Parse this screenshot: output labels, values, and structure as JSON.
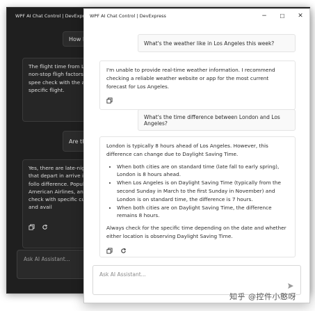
{
  "dark_window": {
    "title": "WPF AI Chat Control | DevExpress",
    "messages": [
      {
        "role": "user",
        "text": "How long"
      },
      {
        "role": "assistant",
        "text": "The flight time from Londo hours for a non-stop fligh factors such as wind spee check with the airline for t specific flight."
      },
      {
        "role": "user",
        "text": "Are there"
      },
      {
        "role": "assistant",
        "text": "Yes, there are late-night fl offer flights that depart in arrive in New York the follo difference. Popular airline American Airlines, and Vir best to check with specific current schedule and avail"
      }
    ],
    "input_placeholder": "Ask AI Assistant..."
  },
  "light_window": {
    "title": "WPF AI Chat Control | DevExpress",
    "controls": {
      "minimize": "−",
      "maximize": "☐",
      "close": "✕"
    },
    "messages": {
      "user1": "What's the weather like in Los Angeles this week?",
      "bot1": "I'm unable to provide real-time weather information. I recommend checking a reliable weather website or app for the most current forecast for Los Angeles.",
      "user2": "What's the time difference between London and Los Angeles?",
      "bot2_intro": "London is typically 8 hours ahead of Los Angeles. However, this difference can change due to Daylight Saving Time.",
      "bot2_bullets": [
        "When both cities are on standard time (late fall to early spring), London is 8 hours ahead.",
        "When Los Angeles is on Daylight Saving Time (typically from the second Sunday in March to the first Sunday in November) and London is on standard time, the difference is 7 hours.",
        "When both cities are on Daylight Saving Time, the difference remains 8 hours."
      ],
      "bot2_outro": "Always check for the specific time depending on the date and whether either location is observing Daylight Saving Time."
    },
    "input_placeholder": "Ask AI Assistant..."
  },
  "watermark": "知乎 @控件小憨呀",
  "colors": {
    "dark_bg": "#1f1f1f",
    "light_bg": "#ffffff",
    "bubble_border": "#e4e4e4"
  }
}
